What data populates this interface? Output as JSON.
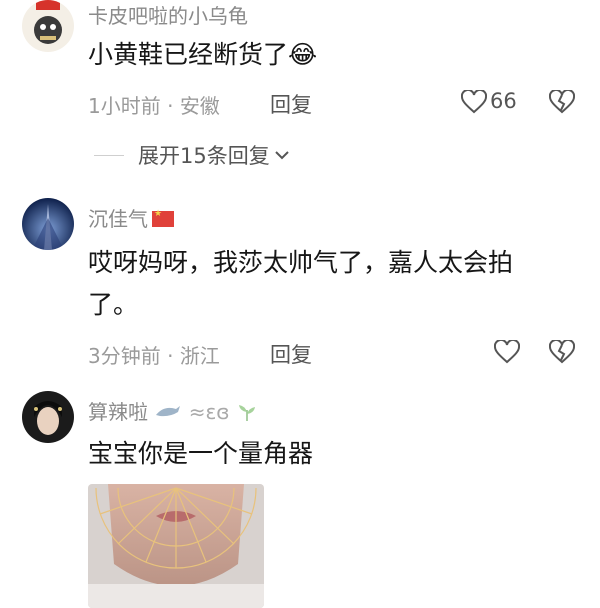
{
  "comments": [
    {
      "username": "卡皮吧啦的小乌龟",
      "text": "小黄鞋已经断货了",
      "emoji": "😂",
      "time": "1小时前",
      "location": "安徽",
      "reply_label": "回复",
      "likes": "66",
      "expand_replies": "展开15条回复"
    },
    {
      "username": "沉佳气",
      "text_line1": "哎呀妈呀，我莎太帅气了，嘉人太会拍",
      "text_line2": "了。",
      "time": "3分钟前",
      "location": "浙江",
      "reply_label": "回复"
    },
    {
      "username": "算辣啦",
      "username_suffix": "≈ɛɞ",
      "text": "宝宝你是一个量角器"
    }
  ],
  "separator": " · "
}
